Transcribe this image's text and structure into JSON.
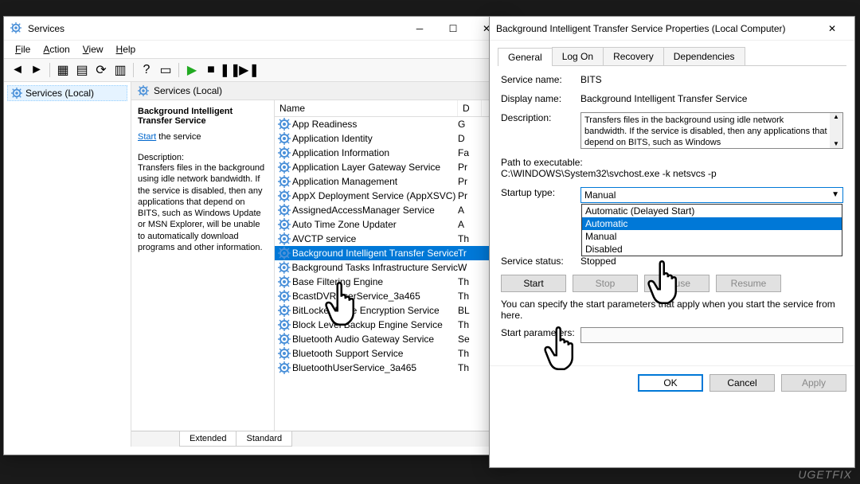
{
  "services_window": {
    "title": "Services",
    "menu": [
      "File",
      "Action",
      "View",
      "Help"
    ],
    "tree_label": "Services (Local)",
    "content_header": "Services (Local)",
    "selected_name": "Background Intelligent Transfer Service",
    "start_link": "Start",
    "start_suffix": " the service",
    "desc_label": "Description:",
    "desc_text": "Transfers files in the background using idle network bandwidth. If the service is disabled, then any applications that depend on BITS, such as Windows Update or MSN Explorer, will be unable to automatically download programs and other information.",
    "col_name": "Name",
    "col_d": "D",
    "rows": [
      {
        "name": "App Readiness",
        "d": "G"
      },
      {
        "name": "Application Identity",
        "d": "D"
      },
      {
        "name": "Application Information",
        "d": "Fa"
      },
      {
        "name": "Application Layer Gateway Service",
        "d": "Pr"
      },
      {
        "name": "Application Management",
        "d": "Pr"
      },
      {
        "name": "AppX Deployment Service (AppXSVC)",
        "d": "Pr"
      },
      {
        "name": "AssignedAccessManager Service",
        "d": "A"
      },
      {
        "name": "Auto Time Zone Updater",
        "d": "A"
      },
      {
        "name": "AVCTP service",
        "d": "Th"
      },
      {
        "name": "Background Intelligent Transfer Service",
        "d": "Tr",
        "sel": true
      },
      {
        "name": "Background Tasks Infrastructure Service",
        "d": "W"
      },
      {
        "name": "Base Filtering Engine",
        "d": "Th"
      },
      {
        "name": "BcastDVRUserService_3a465",
        "d": "Th"
      },
      {
        "name": "BitLocker Drive Encryption Service",
        "d": "BL"
      },
      {
        "name": "Block Level Backup Engine Service",
        "d": "Th"
      },
      {
        "name": "Bluetooth Audio Gateway Service",
        "d": "Se"
      },
      {
        "name": "Bluetooth Support Service",
        "d": "Th"
      },
      {
        "name": "BluetoothUserService_3a465",
        "d": "Th"
      }
    ],
    "tabs": [
      "Extended",
      "Standard"
    ]
  },
  "props": {
    "title": "Background Intelligent Transfer Service Properties (Local Computer)",
    "tabs": [
      "General",
      "Log On",
      "Recovery",
      "Dependencies"
    ],
    "service_name_label": "Service name:",
    "service_name": "BITS",
    "display_name_label": "Display name:",
    "display_name": "Background Intelligent Transfer Service",
    "description_label": "Description:",
    "description": "Transfers files in the background using idle network bandwidth. If the service is disabled, then any applications that depend on BITS, such as Windows",
    "path_label": "Path to executable:",
    "path": "C:\\WINDOWS\\System32\\svchost.exe -k netsvcs -p",
    "startup_label": "Startup type:",
    "startup_value": "Manual",
    "startup_options": [
      "Automatic (Delayed Start)",
      "Automatic",
      "Manual",
      "Disabled"
    ],
    "status_label": "Service status:",
    "status_value": "Stopped",
    "btn_start": "Start",
    "btn_stop": "Stop",
    "btn_pause": "Pause",
    "btn_resume": "Resume",
    "hint": "You can specify the start parameters that apply when you start the service from here.",
    "params_label": "Start parameters:",
    "ok": "OK",
    "cancel": "Cancel",
    "apply": "Apply"
  },
  "watermark": "UGETFIX"
}
